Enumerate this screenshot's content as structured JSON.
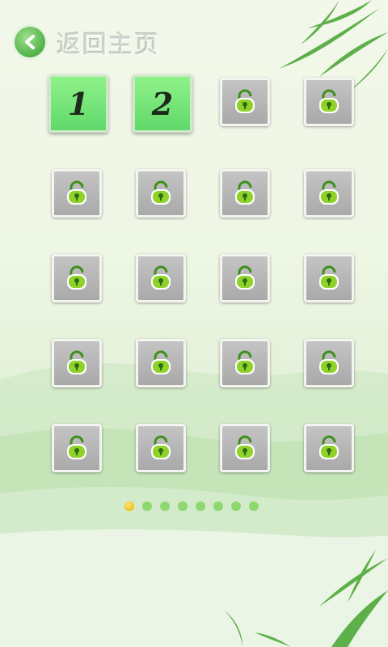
{
  "header": {
    "back_icon": "arrow-left-icon",
    "title": "返回主页"
  },
  "levels": [
    {
      "label": "1",
      "state": "unlocked"
    },
    {
      "label": "2",
      "state": "unlocked"
    },
    {
      "label": "",
      "state": "locked"
    },
    {
      "label": "",
      "state": "locked"
    },
    {
      "label": "",
      "state": "locked"
    },
    {
      "label": "",
      "state": "locked"
    },
    {
      "label": "",
      "state": "locked"
    },
    {
      "label": "",
      "state": "locked"
    },
    {
      "label": "",
      "state": "locked"
    },
    {
      "label": "",
      "state": "locked"
    },
    {
      "label": "",
      "state": "locked"
    },
    {
      "label": "",
      "state": "locked"
    },
    {
      "label": "",
      "state": "locked"
    },
    {
      "label": "",
      "state": "locked"
    },
    {
      "label": "",
      "state": "locked"
    },
    {
      "label": "",
      "state": "locked"
    },
    {
      "label": "",
      "state": "locked"
    },
    {
      "label": "",
      "state": "locked"
    },
    {
      "label": "",
      "state": "locked"
    },
    {
      "label": "",
      "state": "locked"
    }
  ],
  "pager": {
    "pages": 8,
    "current": 1
  },
  "colors": {
    "unlocked_tile": "#6fe070",
    "locked_tile": "#b5b5b5",
    "lock_icon": "#8fd32a",
    "active_dot": "#f0c400",
    "dot": "#8ed870"
  }
}
